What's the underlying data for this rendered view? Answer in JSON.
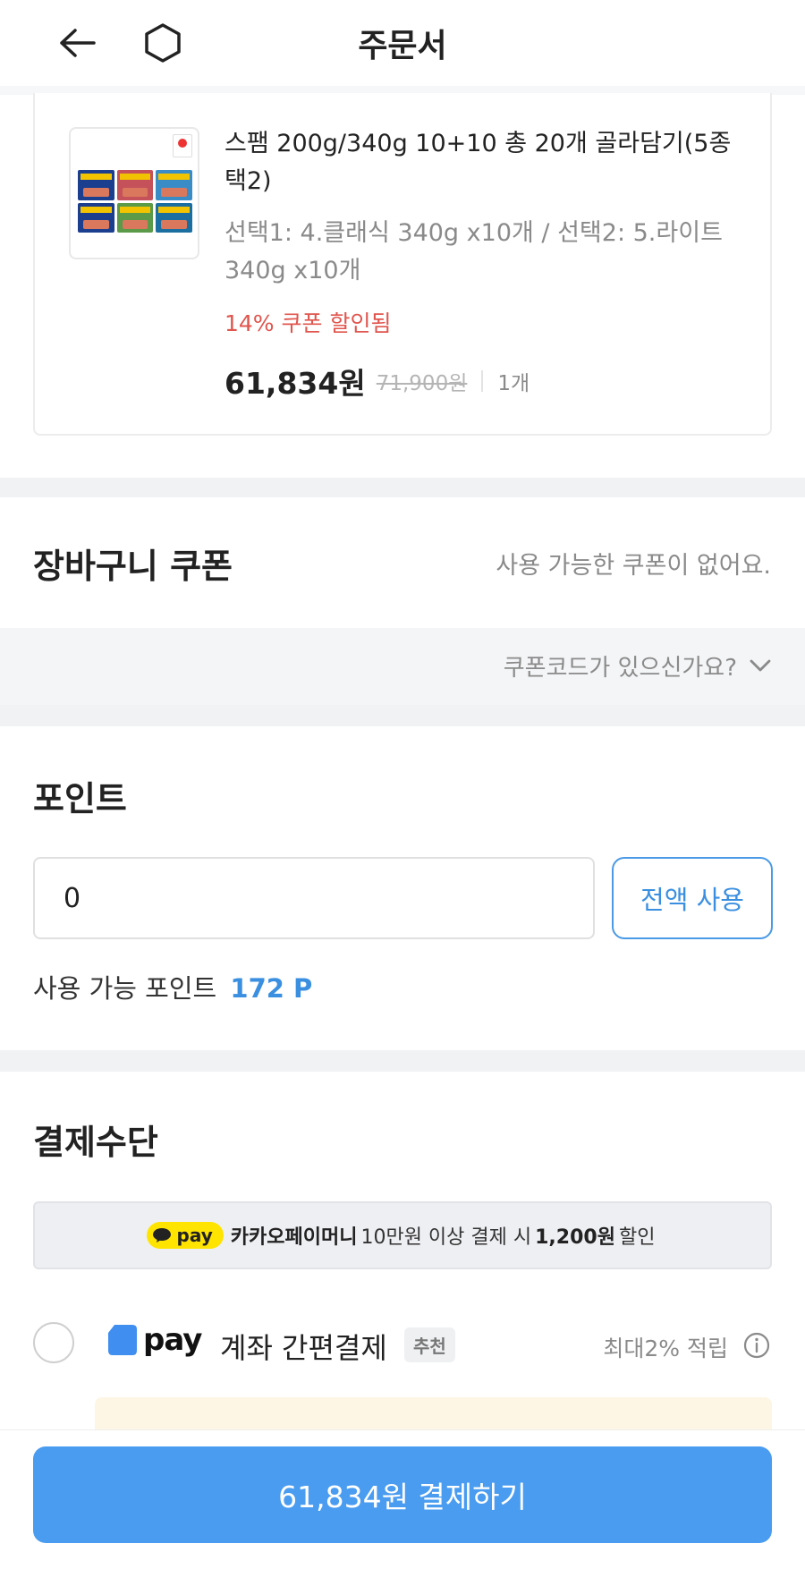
{
  "header": {
    "title": "주문서",
    "back_icon": "arrow-left-icon",
    "home_icon": "home-icon"
  },
  "product": {
    "name": "스팸 200g/340g 10+10 총 20개 골라담기(5종 택2)",
    "option": "선택1: 4.클래식 340g x10개 / 선택2: 5.라이트 340g x10개",
    "coupon_note": "14% 쿠폰 할인됨",
    "price": "61,834원",
    "original_price": "71,900원",
    "quantity": "1개"
  },
  "cart_coupon": {
    "title": "장바구니 쿠폰",
    "status": "사용 가능한 쿠폰이 없어요.",
    "code_prompt": "쿠폰코드가 있으신가요?"
  },
  "points": {
    "title": "포인트",
    "input_value": "0",
    "use_all_label": "전액 사용",
    "available_label": "사용 가능 포인트",
    "available_value": "172 P"
  },
  "payment": {
    "title": "결제수단",
    "kakao_banner": {
      "pill_label": "pay",
      "brand": "카카오페이머니",
      "condition": "10만원 이상 결제 시",
      "discount": "1,200원",
      "suffix": "할인"
    },
    "method": {
      "logo_text": "pay",
      "label": "계좌 간편결제",
      "badge": "추천",
      "benefit": "최대2% 적립"
    }
  },
  "footer": {
    "pay_button_label": "61,834원 결제하기"
  },
  "colors": {
    "accent_blue": "#4a9cf0",
    "coupon_red": "#e0554d",
    "kakao_yellow": "#ffe400"
  }
}
